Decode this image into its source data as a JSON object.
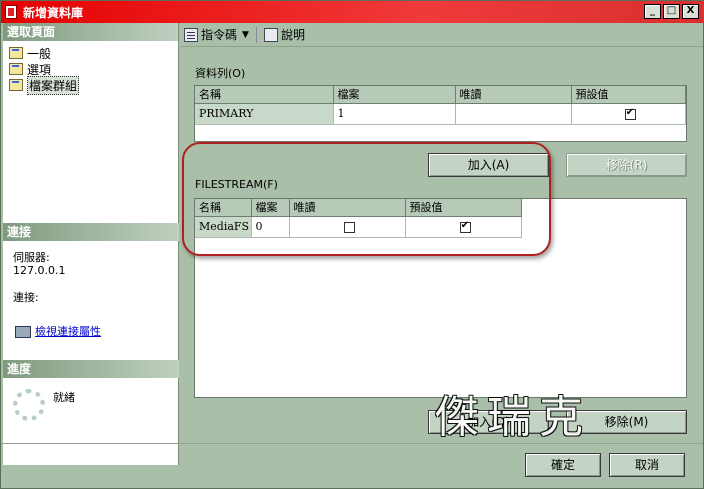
{
  "window": {
    "title": "新增資料庫",
    "controls": [
      "_",
      "□",
      "X"
    ]
  },
  "left": {
    "select_page_header": "選取頁面",
    "nav_items": [
      {
        "label": "一般",
        "icon": "page-icon"
      },
      {
        "label": "選項",
        "icon": "page-icon"
      },
      {
        "label": "檔案群組",
        "icon": "page-icon",
        "selected": true
      }
    ],
    "connection_header": "連接",
    "server_label": "伺服器:",
    "server_value": "127.0.0.1",
    "connection_label": "連接:",
    "view_conn_props": "檢視連接屬性",
    "progress_header": "進度",
    "status": "就緒"
  },
  "toolbar": {
    "script_label": "指令碼",
    "help_label": "說明"
  },
  "rows_section": {
    "label": "資料列(O)",
    "headers": [
      "名稱",
      "檔案",
      "唯讀",
      "預設值"
    ],
    "rows": [
      {
        "name": "PRIMARY",
        "files": "1",
        "readonly": false,
        "default": true
      }
    ],
    "add_label": "加入(A)",
    "remove_label": "移除(R)"
  },
  "filestream_section": {
    "label": "FILESTREAM(F)",
    "headers": [
      "名稱",
      "檔案",
      "唯讀",
      "預設值"
    ],
    "rows": [
      {
        "name": "MediaFS",
        "files": "0",
        "readonly": false,
        "default": true
      }
    ],
    "add_label": "加入(D)",
    "remove_label": "移除(M)"
  },
  "footer": {
    "ok_label": "確定",
    "cancel_label": "取消"
  },
  "watermark": "傑瑞克",
  "colors": {
    "title_bar": "#e60000",
    "panel": "#a9bfa9",
    "header": "#b7c9b7"
  }
}
